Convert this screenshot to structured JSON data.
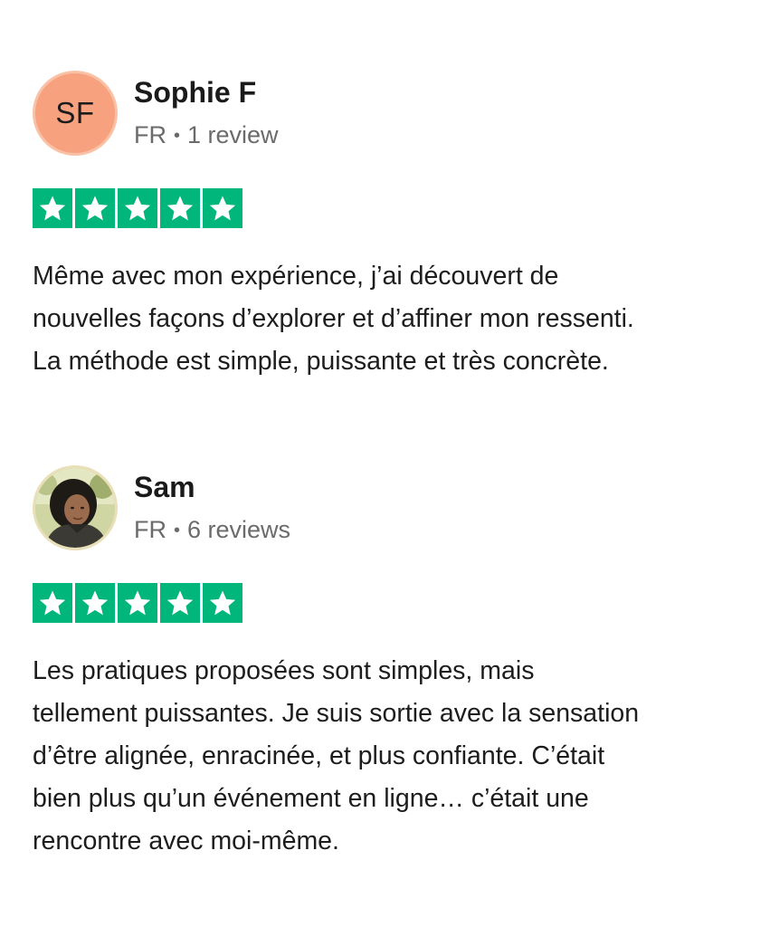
{
  "reviews": [
    {
      "avatar_initials": "SF",
      "name": "Sophie F",
      "country": "FR",
      "separator": "•",
      "review_count": "1 review",
      "rating": 5,
      "text_lines": [
        "Même avec mon expérience, j’ai découvert de",
        "nouvelles façons d’explorer et d’affiner mon ressenti.",
        "La méthode est simple, puissante et très concrète."
      ]
    },
    {
      "avatar_initials": "",
      "name": "Sam",
      "country": "FR",
      "separator": "•",
      "review_count": "6 reviews",
      "rating": 5,
      "text_lines": [
        "Les pratiques proposées sont simples, mais",
        "tellement puissantes. Je suis sortie avec la sensation",
        "d’être alignée, enracinée, et plus confiante. C’était",
        "bien plus qu’un événement en ligne… c’était une",
        "rencontre avec moi-même."
      ]
    }
  ],
  "colors": {
    "star_green": "#00b67a",
    "avatar_peach": "#f7a17f"
  },
  "icons": {
    "star": "star-icon"
  }
}
